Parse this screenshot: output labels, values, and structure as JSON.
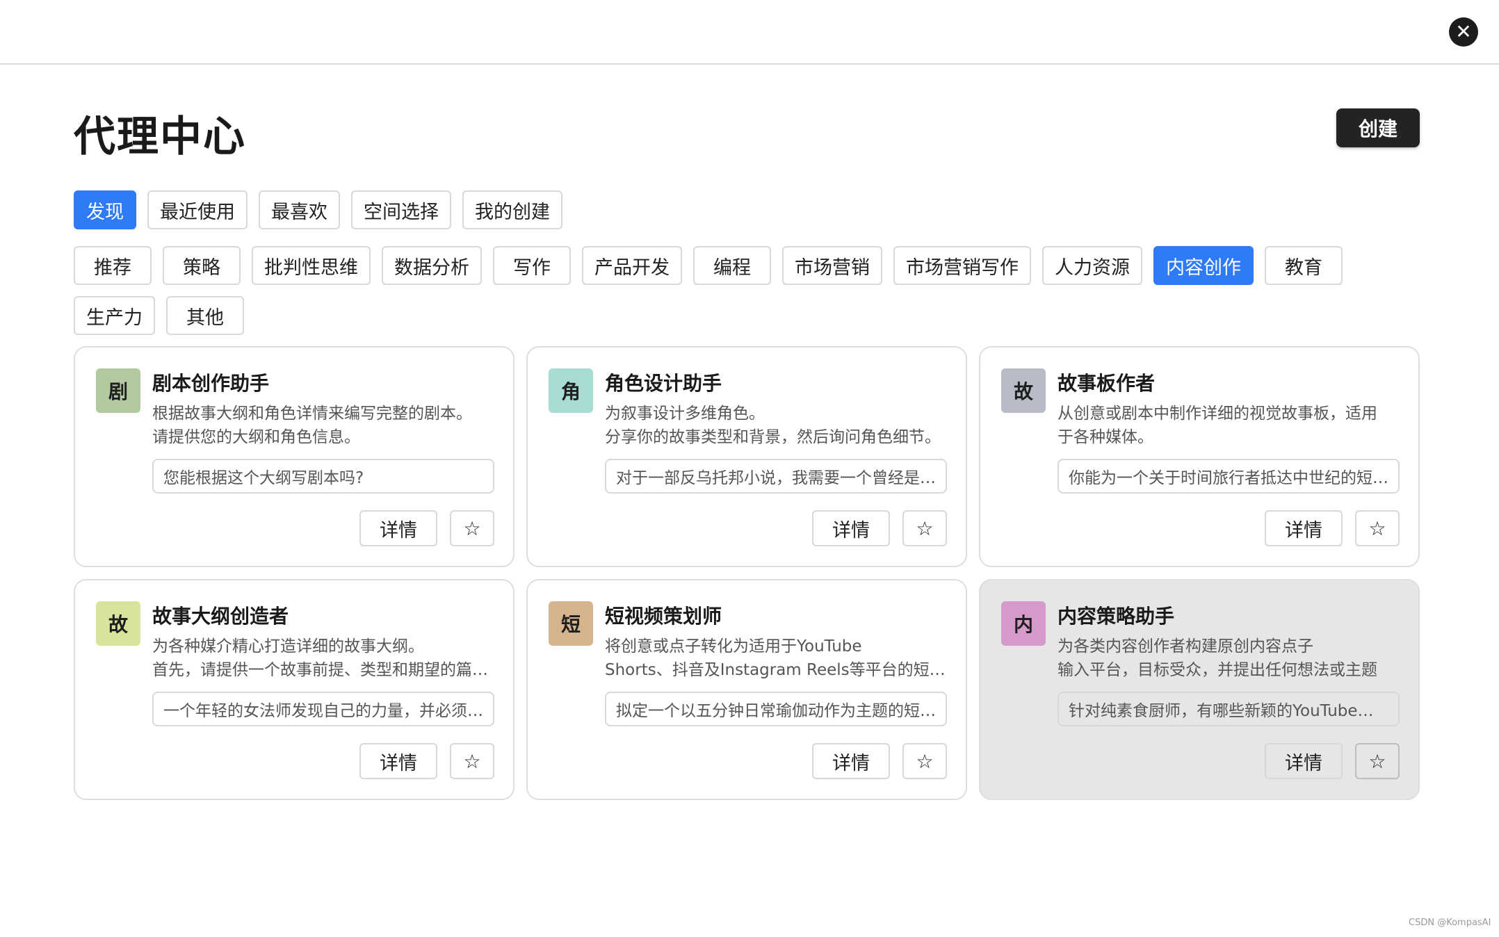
{
  "header": {
    "close_icon": "close-icon"
  },
  "page": {
    "title": "代理中心",
    "create_label": "创建"
  },
  "tabs": [
    {
      "label": "发现",
      "active": true
    },
    {
      "label": "最近使用",
      "active": false
    },
    {
      "label": "最喜欢",
      "active": false
    },
    {
      "label": "空间选择",
      "active": false
    },
    {
      "label": "我的创建",
      "active": false
    }
  ],
  "categories": [
    {
      "label": "推荐",
      "active": false
    },
    {
      "label": "策略",
      "active": false
    },
    {
      "label": "批判性思维",
      "active": false
    },
    {
      "label": "数据分析",
      "active": false
    },
    {
      "label": "写作",
      "active": false
    },
    {
      "label": "产品开发",
      "active": false
    },
    {
      "label": "编程",
      "active": false
    },
    {
      "label": "市场营销",
      "active": false
    },
    {
      "label": "市场营销写作",
      "active": false
    },
    {
      "label": "人力资源",
      "active": false
    },
    {
      "label": "内容创作",
      "active": true
    },
    {
      "label": "教育",
      "active": false
    },
    {
      "label": "生产力",
      "active": false
    },
    {
      "label": "其他",
      "active": false
    }
  ],
  "cards": [
    {
      "avatar": "剧",
      "avatar_color": "#b3c9a0",
      "title": "剧本创作助手",
      "desc": [
        "根据故事大纲和角色详情来编写完整的剧本。",
        "请提供您的大纲和角色信息。"
      ],
      "prompt": "您能根据这个大纲写剧本吗?",
      "detail_label": "详情",
      "fav_icon": "star-icon"
    },
    {
      "avatar": "角",
      "avatar_color": "#a8ddd6",
      "title": "角色设计助手",
      "desc": [
        "为叙事设计多维角色。",
        "分享你的故事类型和背景，然后询问角色细节。"
      ],
      "prompt": "对于一部反乌托邦小说，我需要一个曾经是精英后来反叛的角色",
      "detail_label": "详情",
      "fav_icon": "star-icon"
    },
    {
      "avatar": "故",
      "avatar_color": "#b7bcc6",
      "title": "故事板作者",
      "desc": [
        "从创意或剧本中制作详细的视觉故事板，适用",
        "于各种媒体。"
      ],
      "prompt": "你能为一个关于时间旅行者抵达中世纪的短片制作故事板吗？",
      "detail_label": "详情",
      "fav_icon": "star-icon"
    },
    {
      "avatar": "故",
      "avatar_color": "#d6e59a",
      "title": "故事大纲创造者",
      "desc": [
        "为各种媒介精心打造详细的故事大纲。",
        "首先，请提供一个故事前提、类型和期望的篇幅。"
      ],
      "prompt": "一个年轻的女法师发现自己的力量，并必须拯救她的王国",
      "detail_label": "详情",
      "fav_icon": "star-icon"
    },
    {
      "avatar": "短",
      "avatar_color": "#d6b48e",
      "title": "短视频策划师",
      "desc": [
        "将创意或点子转化为适用于YouTube",
        "Shorts、抖音及Instagram Reels等平台的短视频脚本。"
      ],
      "prompt": "拟定一个以五分钟日常瑜伽动作为主题的短视频",
      "detail_label": "详情",
      "fav_icon": "star-icon"
    },
    {
      "avatar": "内",
      "avatar_color": "#d59ac9",
      "title": "内容策略助手",
      "desc": [
        "为各类内容创作者构建原创内容点子",
        "输入平台，目标受众，并提出任何想法或主题"
      ],
      "prompt": "针对纯素食厨师，有哪些新颖的YouTube视频创意？",
      "detail_label": "详情",
      "fav_icon": "star-icon"
    }
  ],
  "watermark": "CSDN @KompasAI"
}
